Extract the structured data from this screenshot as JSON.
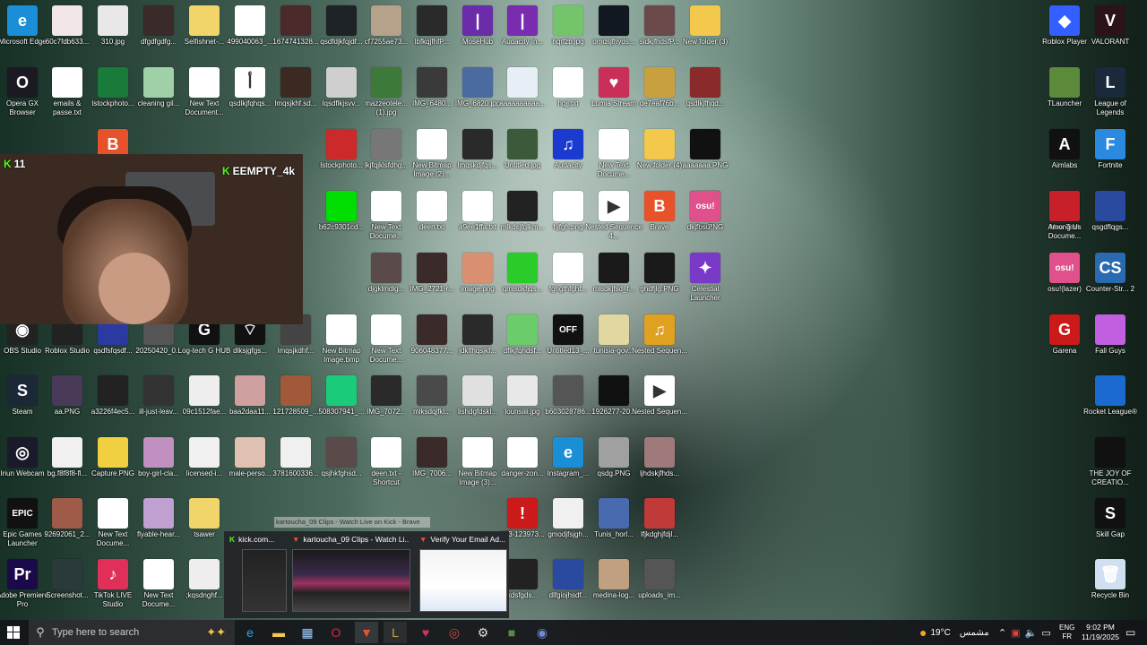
{
  "desktop_icons": [
    {
      "label": "Microsoft Edge",
      "icon": "edge-icon",
      "color": "#1a8fd6",
      "glyph": "e"
    },
    {
      "label": "60c7fdb633...",
      "icon": "image-icon",
      "color": "#f3e6e6",
      "glyph": ""
    },
    {
      "label": "310.jpg",
      "icon": "image-icon",
      "color": "#e8e8e8",
      "glyph": ""
    },
    {
      "label": "dfgdfgdfg...",
      "icon": "image-icon",
      "color": "#3b2a2a",
      "glyph": ""
    },
    {
      "label": "Selfishnet-...",
      "icon": "zip-icon",
      "color": "#f2d56a",
      "glyph": ""
    },
    {
      "label": "499040063_...",
      "icon": "file-icon",
      "color": "#ffffff",
      "glyph": ""
    },
    {
      "label": "1674741328...",
      "icon": "image-icon",
      "color": "#4a2a2a",
      "glyph": ""
    },
    {
      "label": "qsdfdjkfqjdf...",
      "icon": "image-icon",
      "color": "#1e2328",
      "glyph": ""
    },
    {
      "label": "cf7255ae73...",
      "icon": "image-icon",
      "color": "#b6a18a",
      "glyph": ""
    },
    {
      "label": "lbfkqjfhfP...",
      "icon": "image-icon",
      "color": "#2a2a2a",
      "glyph": ""
    },
    {
      "label": "MoseHub",
      "icon": "app-icon",
      "color": "#6a2ca8",
      "glyph": "|"
    },
    {
      "label": "Audacity In...",
      "icon": "app-icon",
      "color": "#7a2cb0",
      "glyph": "|"
    },
    {
      "label": "hqrfzb.jpg",
      "icon": "image-icon",
      "color": "#73c46b",
      "glyph": ""
    },
    {
      "label": "omdsjfhyds...",
      "icon": "image-icon",
      "color": "#111820",
      "glyph": ""
    },
    {
      "label": "sldkjfhdsfP...",
      "icon": "image-icon",
      "color": "#6a4a4a",
      "glyph": ""
    },
    {
      "label": "New folder (3)",
      "icon": "folder-icon",
      "color": "#f2c94c",
      "glyph": ""
    },
    {
      "label": "Roblox Player",
      "icon": "roblox-icon",
      "color": "#335fff",
      "glyph": "◆"
    },
    {
      "label": "VALORANT",
      "icon": "valorant-icon",
      "color": "#2a1418",
      "glyph": "V"
    },
    {
      "label": "Opera GX Browser",
      "icon": "opera-gx-icon",
      "color": "#1b1a22",
      "glyph": "O"
    },
    {
      "label": "emails & passe.txt",
      "icon": "text-file-icon",
      "color": "#ffffff",
      "glyph": ""
    },
    {
      "label": "lstockphoto...",
      "icon": "image-icon",
      "color": "#1a7a3a",
      "glyph": ""
    },
    {
      "label": "cleaning gil...",
      "icon": "image-icon",
      "color": "#9fd0a6",
      "glyph": ""
    },
    {
      "label": "New Text Document...",
      "icon": "text-file-icon",
      "color": "#ffffff",
      "glyph": ""
    },
    {
      "label": "qsdlkjfqhqs...",
      "icon": "image-icon",
      "color": "#ffffff",
      "glyph": "أ"
    },
    {
      "label": "lmqsjkhf.sd...",
      "icon": "image-icon",
      "color": "#3a2a22",
      "glyph": ""
    },
    {
      "label": "lqsdflkjsvv...",
      "icon": "image-icon",
      "color": "#cfcfcf",
      "glyph": ""
    },
    {
      "label": "mazzeotele... (1).jpg",
      "icon": "image-icon",
      "color": "#3d7a3a",
      "glyph": ""
    },
    {
      "label": "IMG_6480...",
      "icon": "image-icon",
      "color": "#3a3a3a",
      "glyph": ""
    },
    {
      "label": "IMG_6820.jpg",
      "icon": "image-icon",
      "color": "#4a6aa0",
      "glyph": ""
    },
    {
      "label": "aaaaaaaaaa...",
      "icon": "image-icon",
      "color": "#e8eef5",
      "glyph": ""
    },
    {
      "label": "hqjj.txt",
      "icon": "text-file-icon",
      "color": "#ffffff",
      "glyph": ""
    },
    {
      "label": "Lumia Stream",
      "icon": "lumia-icon",
      "color": "#c8305a",
      "glyph": "♥"
    },
    {
      "label": "de7eaf76b...",
      "icon": "image-icon",
      "color": "#c8a040",
      "glyph": ""
    },
    {
      "label": "qsdlkjfhqd...",
      "icon": "image-icon",
      "color": "#8a2a2a",
      "glyph": ""
    },
    {
      "label": "TLauncher",
      "icon": "tlauncher-icon",
      "color": "#5a8a3a",
      "glyph": ""
    },
    {
      "label": "League of Legends",
      "icon": "league-icon",
      "color": "#1a2a3a",
      "glyph": "L"
    },
    {
      "label": "Brave",
      "icon": "brave-icon",
      "color": "#e8522a",
      "glyph": "B"
    },
    {
      "label": "lstockphoto...",
      "icon": "image-icon",
      "color": "#cc2a2a",
      "glyph": ""
    },
    {
      "label": "lkjfqjklsfdhg...",
      "icon": "image-icon",
      "color": "#777",
      "glyph": ""
    },
    {
      "label": "New Bitmap Image (2)...",
      "icon": "bitmap-icon",
      "color": "#ffffff",
      "glyph": ""
    },
    {
      "label": "lmqskdjfqs...",
      "icon": "image-icon",
      "color": "#2a2a2a",
      "glyph": ""
    },
    {
      "label": "Untitled.jpg",
      "icon": "image-icon",
      "color": "#3a5a3a",
      "glyph": ""
    },
    {
      "label": "Audacity",
      "icon": "audacity-icon",
      "color": "#1a3ad0",
      "glyph": "♫"
    },
    {
      "label": "New Text Docume...",
      "icon": "text-file-icon",
      "color": "#ffffff",
      "glyph": ""
    },
    {
      "label": "New folder (4)",
      "icon": "folder-icon",
      "color": "#f2c94c",
      "glyph": ""
    },
    {
      "label": "aaaaaaa.PNG",
      "icon": "image-icon",
      "color": "#111",
      "glyph": ""
    },
    {
      "label": "Aimlabs",
      "icon": "aimlabs-icon",
      "color": "#111",
      "glyph": "A"
    },
    {
      "label": "Fortnite",
      "icon": "fortnite-icon",
      "color": "#2a8ae0",
      "glyph": "F"
    },
    {
      "label": "b62c9301cd...",
      "icon": "image-icon",
      "color": "#00dd00",
      "glyph": ""
    },
    {
      "label": "New Text Docume...",
      "icon": "text-file-icon",
      "color": "#ffffff",
      "glyph": ""
    },
    {
      "label": "deen.txt",
      "icon": "text-file-icon",
      "color": "#ffffff",
      "glyph": ""
    },
    {
      "label": "a9ee1ffa.txt",
      "icon": "text-file-icon",
      "color": "#ffffff",
      "glyph": ""
    },
    {
      "label": "mlkdsjfqlkm...",
      "icon": "image-icon",
      "color": "#222",
      "glyph": ""
    },
    {
      "label": "hjfgh.png",
      "icon": "image-icon",
      "color": "#ffffff",
      "glyph": ""
    },
    {
      "label": "Nested Sequence 4...",
      "icon": "video-icon",
      "color": "#ffffff",
      "glyph": "▶"
    },
    {
      "label": "Brave",
      "icon": "brave-icon",
      "color": "#e8522a",
      "glyph": "B"
    },
    {
      "label": "dkjfhs.PNG",
      "icon": "image-icon",
      "color": "#2a3a8a",
      "glyph": ""
    },
    {
      "label": "New Text Docume...",
      "icon": "text-file-icon",
      "color": "#ffffff",
      "glyph": ""
    },
    {
      "label": "osu!",
      "icon": "osu-icon",
      "color": "#e0508a",
      "glyph": "osu!"
    },
    {
      "label": "Among Us",
      "icon": "among-us-icon",
      "color": "#c8202a",
      "glyph": ""
    },
    {
      "label": "qsgdflqgs...",
      "icon": "image-icon",
      "color": "#2a4aa0",
      "glyph": ""
    },
    {
      "label": "djgklmdlg...",
      "icon": "image-icon",
      "color": "#5a4a4a",
      "glyph": ""
    },
    {
      "label": "IMG_2721-r...",
      "icon": "image-icon",
      "color": "#3a2a2a",
      "glyph": ""
    },
    {
      "label": "image.png",
      "icon": "image-icon",
      "color": "#d89070",
      "glyph": ""
    },
    {
      "label": "qmlsdkfjqs...",
      "icon": "image-icon",
      "color": "#2acc2a",
      "glyph": ""
    },
    {
      "label": "fghgfhfghf...",
      "icon": "image-icon",
      "color": "#ffffff",
      "glyph": ""
    },
    {
      "label": "mlsdkjfsd_f...",
      "icon": "image-icon",
      "color": "#1a1a1a",
      "glyph": ""
    },
    {
      "label": "ghdfjlg.PNG",
      "icon": "image-icon",
      "color": "#1a1a1a",
      "glyph": ""
    },
    {
      "label": "Celestial Launcher",
      "icon": "celestial-icon",
      "color": "#7a3ac8",
      "glyph": "✦"
    },
    {
      "label": "osu!(lazer)",
      "icon": "osu-lazer-icon",
      "color": "#e0508a",
      "glyph": "osu!"
    },
    {
      "label": "Counter-Str... 2",
      "icon": "cs2-icon",
      "color": "#2a6ab0",
      "glyph": "CS"
    },
    {
      "label": "OBS Studio",
      "icon": "obs-icon",
      "color": "#222",
      "glyph": "◉"
    },
    {
      "label": "Roblox Studio",
      "icon": "roblox-studio-icon",
      "color": "#222",
      "glyph": ""
    },
    {
      "label": "qsdfsfqsdf...",
      "icon": "image-icon",
      "color": "#2a3aa0",
      "glyph": ""
    },
    {
      "label": "20250420_0...",
      "icon": "image-icon",
      "color": "#555",
      "glyph": ""
    },
    {
      "label": "Log-tech G HUB",
      "icon": "ghub-icon",
      "color": "#111",
      "glyph": "G"
    },
    {
      "label": "dlksjgfgs...",
      "icon": "wifi-icon",
      "color": "#111",
      "glyph": "⌔"
    },
    {
      "label": "lmqsjkdhf...",
      "icon": "image-icon",
      "color": "#444",
      "glyph": ""
    },
    {
      "label": "New Bitmap Image.bmp",
      "icon": "bitmap-icon",
      "color": "#ffffff",
      "glyph": ""
    },
    {
      "label": "New Text Docume...",
      "icon": "text-file-icon",
      "color": "#ffffff",
      "glyph": ""
    },
    {
      "label": "906048377...",
      "icon": "image-icon",
      "color": "#3a2a2a",
      "glyph": ""
    },
    {
      "label": "jdklfhqsjkf...",
      "icon": "image-icon",
      "color": "#2a2a2a",
      "glyph": ""
    },
    {
      "label": "dflkjfqhdsf...",
      "icon": "image-icon",
      "color": "#6acc6a",
      "glyph": ""
    },
    {
      "label": "Untitled13_...",
      "icon": "image-icon",
      "color": "#111",
      "glyph": "OFF"
    },
    {
      "label": "tunisia-gov...",
      "icon": "image-icon",
      "color": "#e0d8a0",
      "glyph": ""
    },
    {
      "label": "Nested Sequen...",
      "icon": "audio-icon",
      "color": "#e0a020",
      "glyph": "♫"
    },
    {
      "label": "Garena",
      "icon": "garena-icon",
      "color": "#cc1a1a",
      "glyph": "G"
    },
    {
      "label": "Fall Guys",
      "icon": "fall-guys-icon",
      "color": "#c060e0",
      "glyph": ""
    },
    {
      "label": "Steam",
      "icon": "steam-icon",
      "color": "#1b2838",
      "glyph": "S"
    },
    {
      "label": "aa.PNG",
      "icon": "image-icon",
      "color": "#4a3a5a",
      "glyph": ""
    },
    {
      "label": "a3226f4ec5...",
      "icon": "image-icon",
      "color": "#222",
      "glyph": ""
    },
    {
      "label": "ill-just-leav...",
      "icon": "image-icon",
      "color": "#333",
      "glyph": ""
    },
    {
      "label": "09c1512fae...",
      "icon": "image-icon",
      "color": "#eee",
      "glyph": ""
    },
    {
      "label": "baa2daa11...",
      "icon": "image-icon",
      "color": "#d0a0a0",
      "glyph": ""
    },
    {
      "label": "121728509_...",
      "icon": "image-icon",
      "color": "#a05a3a",
      "glyph": ""
    },
    {
      "label": "508307941_...",
      "icon": "image-icon",
      "color": "#1acc7a",
      "glyph": ""
    },
    {
      "label": "IMG_7072...",
      "icon": "image-icon",
      "color": "#2a2a2a",
      "glyph": ""
    },
    {
      "label": "mlksdqjfkl...",
      "icon": "image-icon",
      "color": "#4a4a4a",
      "glyph": ""
    },
    {
      "label": "lishdgfdskl...",
      "icon": "image-icon",
      "color": "#e0e0e0",
      "glyph": ""
    },
    {
      "label": "lounsiiii.jpg",
      "icon": "image-icon",
      "color": "#e8e8e8",
      "glyph": ""
    },
    {
      "label": "b603028786...",
      "icon": "image-icon",
      "color": "#555",
      "glyph": ""
    },
    {
      "label": "1926277-20...",
      "icon": "image-icon",
      "color": "#111",
      "glyph": ""
    },
    {
      "label": "Nested Sequen...",
      "icon": "video-icon",
      "color": "#ffffff",
      "glyph": "▶"
    },
    {
      "label": "Rocket League®",
      "icon": "rocket-league-icon",
      "color": "#1a6ad0",
      "glyph": ""
    },
    {
      "label": "Iriun Webcam",
      "icon": "iriun-icon",
      "color": "#1a1a2a",
      "glyph": "◎"
    },
    {
      "label": "bg.f8f8f8-fl...",
      "icon": "image-icon",
      "color": "#f0f0f0",
      "glyph": ""
    },
    {
      "label": "Capture.PNG",
      "icon": "image-icon",
      "color": "#f0d040",
      "glyph": ""
    },
    {
      "label": "boy-girl-cla...",
      "icon": "image-icon",
      "color": "#c090c0",
      "glyph": ""
    },
    {
      "label": "licensed-i...",
      "icon": "image-icon",
      "color": "#f0f0f0",
      "glyph": ""
    },
    {
      "label": "male-perso...",
      "icon": "image-icon",
      "color": "#e0c0b0",
      "glyph": ""
    },
    {
      "label": "3781600336...",
      "icon": "image-icon",
      "color": "#f0f0f0",
      "glyph": ""
    },
    {
      "label": "qsjhkfghsd...",
      "icon": "image-icon",
      "color": "#5a4a4a",
      "glyph": ""
    },
    {
      "label": "deen.txt - Shortcut",
      "icon": "shortcut-icon",
      "color": "#ffffff",
      "glyph": ""
    },
    {
      "label": "IMG_7006...",
      "icon": "image-icon",
      "color": "#3a2a2a",
      "glyph": ""
    },
    {
      "label": "New Bitmap Image (3)...",
      "icon": "bitmap-icon",
      "color": "#ffffff",
      "glyph": ""
    },
    {
      "label": "danger-zon...",
      "icon": "image-icon",
      "color": "#ffffff",
      "glyph": ""
    },
    {
      "label": "Instagram_...",
      "icon": "edge-icon",
      "color": "#1a8fd6",
      "glyph": "e"
    },
    {
      "label": "qsdg.PNG",
      "icon": "image-icon",
      "color": "#a0a0a0",
      "glyph": ""
    },
    {
      "label": "ljhdskjfhds...",
      "icon": "image-icon",
      "color": "#a07a7a",
      "glyph": ""
    },
    {
      "label": "THE JOY OF CREATIO...",
      "icon": "joy-icon",
      "color": "#111",
      "glyph": ""
    },
    {
      "label": "Epic Games Launcher",
      "icon": "epic-games-icon",
      "color": "#111",
      "glyph": "EPIC"
    },
    {
      "label": "92692061_2...",
      "icon": "image-icon",
      "color": "#a05a4a",
      "glyph": ""
    },
    {
      "label": "New Text Docume...",
      "icon": "text-file-icon",
      "color": "#ffffff",
      "glyph": ""
    },
    {
      "label": "flyable-hear...",
      "icon": "image-icon",
      "color": "#c0a0d0",
      "glyph": ""
    },
    {
      "label": "tsawer",
      "icon": "zip-icon",
      "color": "#f2d56a",
      "glyph": ""
    },
    {
      "label": "123-123973...",
      "icon": "image-icon",
      "color": "#cc1a1a",
      "glyph": "!"
    },
    {
      "label": "gmodjfsjgh...",
      "icon": "image-icon",
      "color": "#f0f0f0",
      "glyph": ""
    },
    {
      "label": "Tunis_horl...",
      "icon": "image-icon",
      "color": "#4a6ab0",
      "glyph": ""
    },
    {
      "label": "lfjkdghjfdjl...",
      "icon": "image-icon",
      "color": "#c03a3a",
      "glyph": ""
    },
    {
      "label": "Skill Gap",
      "icon": "skill-gap-icon",
      "color": "#111",
      "glyph": "S"
    },
    {
      "label": "Adobe Premiere Pro",
      "icon": "premiere-icon",
      "color": "#1a0a4a",
      "glyph": "Pr"
    },
    {
      "label": "Screenshot...",
      "icon": "image-icon",
      "color": "#2a3a3a",
      "glyph": ""
    },
    {
      "label": "TikTok LIVE Studio",
      "icon": "tiktok-icon",
      "color": "#e0305a",
      "glyph": "♪"
    },
    {
      "label": "New Text Docume...",
      "icon": "text-file-icon",
      "color": "#ffffff",
      "glyph": ""
    },
    {
      "label": ";kqsdnghf...",
      "icon": "image-icon",
      "color": "#eee",
      "glyph": ""
    },
    {
      "label": "kdsfgds...",
      "icon": "image-icon",
      "color": "#222",
      "glyph": ""
    },
    {
      "label": "dlfgiojhsdf...",
      "icon": "image-icon",
      "color": "#2a4aa0",
      "glyph": ""
    },
    {
      "label": "medina-log...",
      "icon": "image-icon",
      "color": "#c0a080",
      "glyph": ""
    },
    {
      "label": "uploads_im...",
      "icon": "image-icon",
      "color": "#555",
      "glyph": ""
    },
    {
      "label": "Recycle Bin",
      "icon": "recycle-bin-icon",
      "color": "#d0e0f0",
      "glyph": "🗑"
    }
  ],
  "webcam": {
    "viewer_count": "11",
    "channel": "EEMPTY_4k"
  },
  "taskbar": {
    "search_placeholder": "Type here to search",
    "weather": "19°C",
    "weather_desc": "مشمس",
    "lang_1": "ENG",
    "lang_2": "FR",
    "time": "9:02 PM",
    "date": "11/19/2025"
  },
  "preview": {
    "tooltip": "kartoucha_09 Clips - Watch Live on Kick - Brave",
    "thumbs": [
      {
        "title": "kick.com..."
      },
      {
        "title": "kartoucha_09 Clips - Watch Li..."
      },
      {
        "title": "Verify Your Email Ad..."
      }
    ]
  }
}
